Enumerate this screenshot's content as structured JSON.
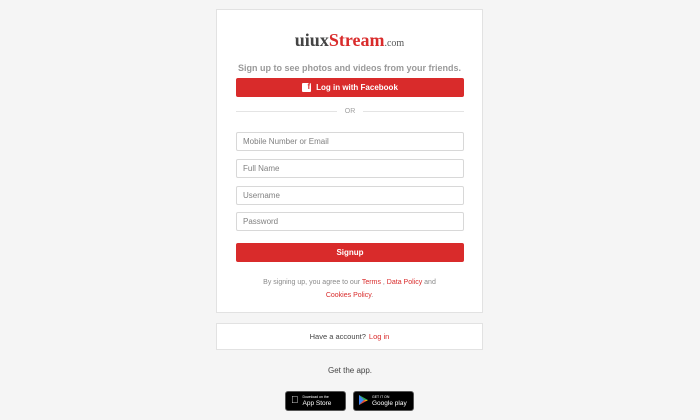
{
  "logo": {
    "prefix": "uiux",
    "accent": "Stream",
    "tld": ".com"
  },
  "tagline": "Sign up to see photos and videos from your friends.",
  "facebook_button": {
    "icon": "facebook-icon",
    "label": "Log in with Facebook"
  },
  "divider_text": "OR",
  "fields": {
    "mobile_or_email": {
      "placeholder": "Mobile Number or Email",
      "value": ""
    },
    "full_name": {
      "placeholder": "Full Name",
      "value": ""
    },
    "username": {
      "placeholder": "Username",
      "value": ""
    },
    "password": {
      "placeholder": "Password",
      "value": ""
    }
  },
  "signup_button": "Signup",
  "terms": {
    "prefix": "By signing up, you agree to our",
    "terms_link": "Terms",
    "separator": " ,",
    "data_policy_link": "Data Policy",
    "and": "and",
    "cookies_link": "Cookies Policy",
    "suffix": "."
  },
  "login_prompt": {
    "text": "Have a account?",
    "link": "Log in"
  },
  "get_app": "Get the app.",
  "stores": {
    "app_store": {
      "icon": "apple-icon",
      "small": "Download on the",
      "big": "App Store"
    },
    "google_play": {
      "icon": "google-play-icon",
      "small": "GET IT ON",
      "big": "Google play"
    }
  },
  "colors": {
    "accent": "#d92b2b",
    "background": "#f5f5f5"
  }
}
